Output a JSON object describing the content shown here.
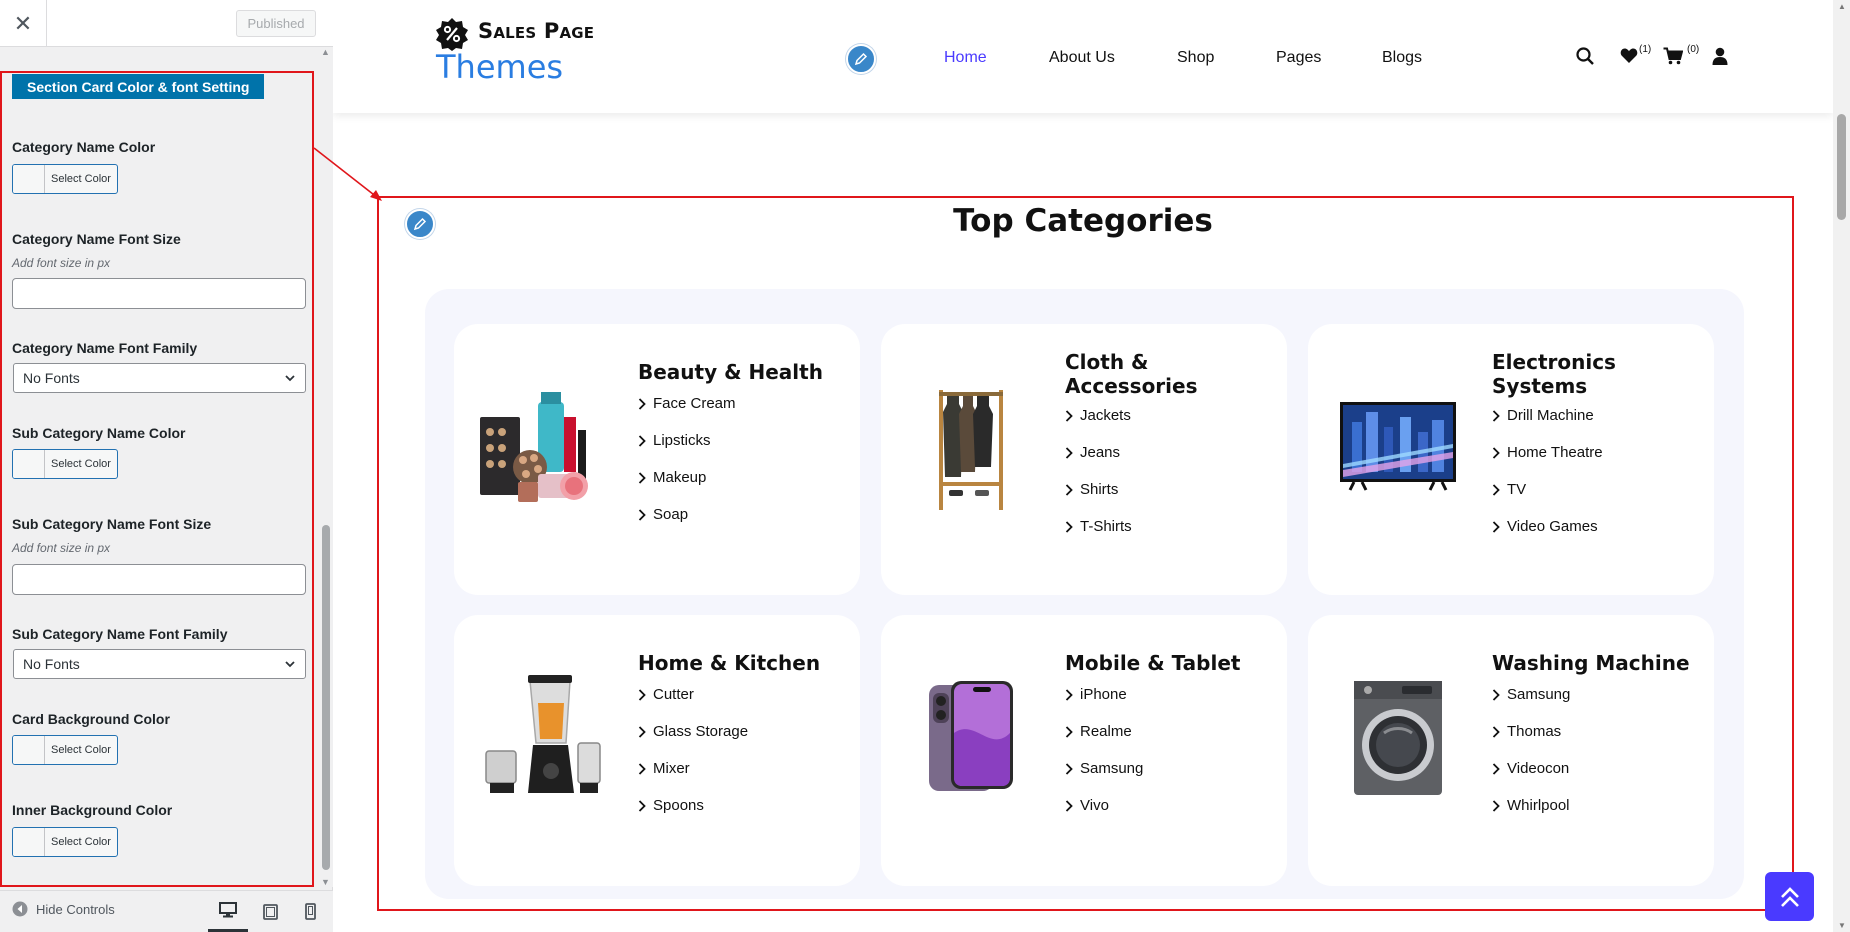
{
  "sidebar": {
    "close_icon": "close-icon",
    "published_label": "Published",
    "section_title": "Section Card Color & font Setting",
    "controls": {
      "cat_color": {
        "label": "Category Name Color",
        "button": "Select Color"
      },
      "cat_font_size": {
        "label": "Category Name Font Size",
        "description": "Add font size in px",
        "value": ""
      },
      "cat_font_family": {
        "label": "Category Name Font Family",
        "selected": "No Fonts"
      },
      "sub_color": {
        "label": "Sub Category Name Color",
        "button": "Select Color"
      },
      "sub_font_size": {
        "label": "Sub Category Name Font Size",
        "description": "Add font size in px",
        "value": ""
      },
      "sub_font_family": {
        "label": "Sub Category Name Font Family",
        "selected": "No Fonts"
      },
      "card_bg": {
        "label": "Card Background Color",
        "button": "Select Color"
      },
      "inner_bg": {
        "label": "Inner Background Color",
        "button": "Select Color"
      }
    },
    "footer": {
      "hide_controls": "Hide Controls",
      "devices": [
        "desktop-icon",
        "tablet-icon",
        "mobile-icon"
      ],
      "active_device": "desktop"
    }
  },
  "site": {
    "logo_name": "Sales Page",
    "logo_sub": "Themes",
    "nav": [
      "Home",
      "About Us",
      "Shop",
      "Pages",
      "Blogs"
    ],
    "active_nav": "Home",
    "wishlist_count": "(1)",
    "cart_count": "(0)",
    "accent_color": "#4a3aff",
    "brand_blue": "#2a7de1",
    "outline_color": "#e0161b"
  },
  "section": {
    "title": "Top Categories",
    "categories": [
      {
        "name": "Beauty & Health",
        "image": "cosmetics-image",
        "subs": [
          "Face Cream",
          "Lipsticks",
          "Makeup",
          "Soap"
        ]
      },
      {
        "name": "Cloth & Accessories",
        "image": "clothing-rack-image",
        "subs": [
          "Jackets",
          "Jeans",
          "Shirts",
          "T-Shirts"
        ]
      },
      {
        "name": "Electronics Systems",
        "image": "television-image",
        "subs": [
          "Drill Machine",
          "Home Theatre",
          "TV",
          "Video Games"
        ]
      },
      {
        "name": "Home & Kitchen",
        "image": "blender-image",
        "subs": [
          "Cutter",
          "Glass Storage",
          "Mixer",
          "Spoons"
        ]
      },
      {
        "name": "Mobile & Tablet",
        "image": "smartphone-image",
        "subs": [
          "iPhone",
          "Realme",
          "Samsung",
          "Vivo"
        ]
      },
      {
        "name": "Washing Machine",
        "image": "washing-machine-image",
        "subs": [
          "Samsung",
          "Thomas",
          "Videocon",
          "Whirlpool"
        ]
      }
    ]
  }
}
